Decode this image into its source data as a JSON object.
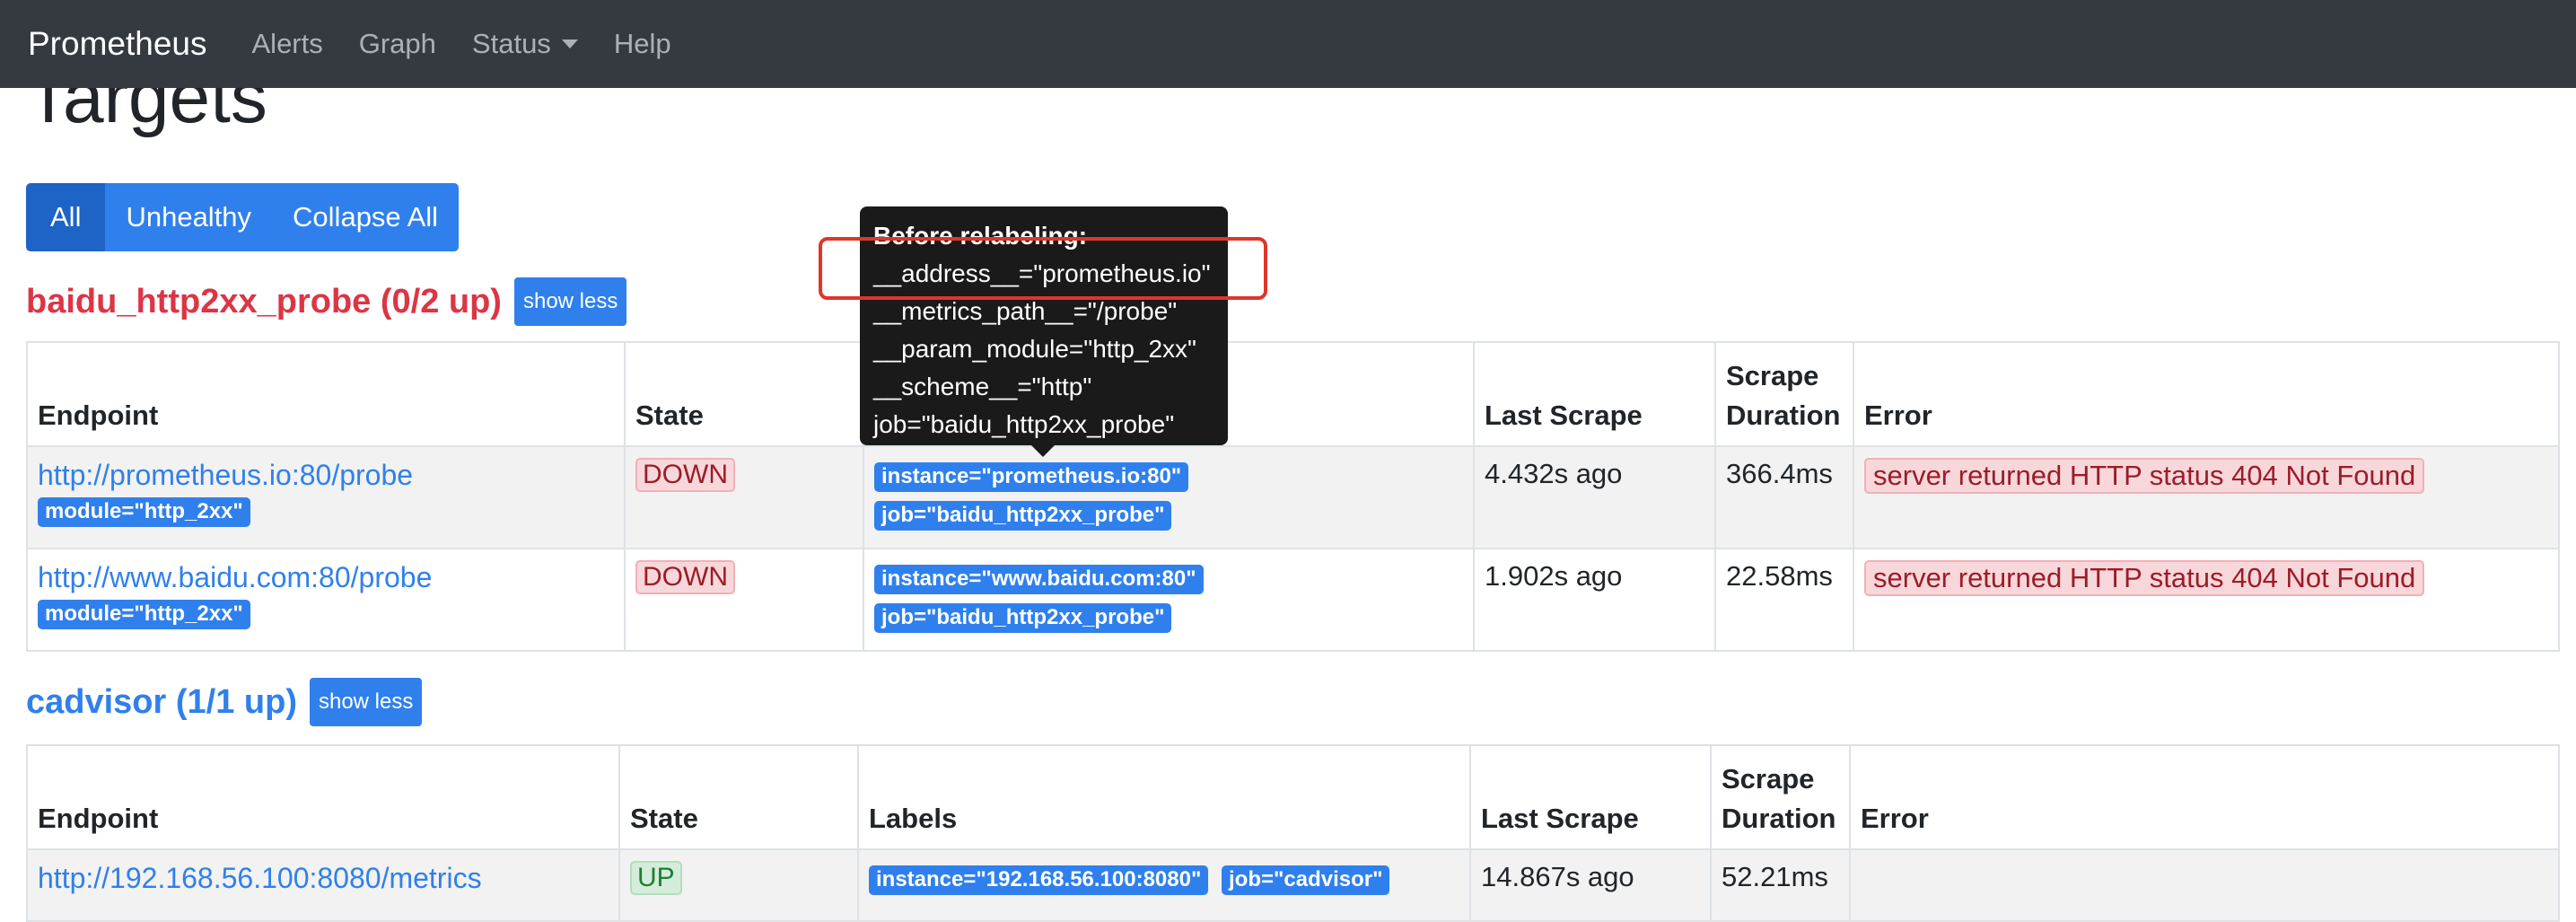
{
  "navbar": {
    "brand": "Prometheus",
    "items": [
      {
        "label": "Alerts"
      },
      {
        "label": "Graph"
      },
      {
        "label": "Status"
      },
      {
        "label": "Help"
      }
    ]
  },
  "page": {
    "title": "Targets"
  },
  "filter_buttons": {
    "all": "All",
    "unhealthy": "Unhealthy",
    "collapse": "Collapse All"
  },
  "table_headers": {
    "endpoint": "Endpoint",
    "state": "State",
    "labels": "Labels",
    "last_scrape": "Last Scrape",
    "scrape_duration_1": "Scrape",
    "scrape_duration_2": "Duration",
    "error": "Error"
  },
  "pools": [
    {
      "title": "baidu_http2xx_probe (0/2 up)",
      "toggle_label": "show less",
      "status_color": "#dc3545",
      "rows": [
        {
          "endpoint": "http://prometheus.io:80/probe",
          "endpoint_params": "module=\"http_2xx\"",
          "state": "DOWN",
          "labels": [
            "instance=\"prometheus.io:80\"",
            "job=\"baidu_http2xx_probe\""
          ],
          "last_scrape": "4.432s ago",
          "scrape_duration": "366.4ms",
          "error": "server returned HTTP status 404 Not Found"
        },
        {
          "endpoint": "http://www.baidu.com:80/probe",
          "endpoint_params": "module=\"http_2xx\"",
          "state": "DOWN",
          "labels": [
            "instance=\"www.baidu.com:80\"",
            "job=\"baidu_http2xx_probe\""
          ],
          "last_scrape": "1.902s ago",
          "scrape_duration": "22.58ms",
          "error": "server returned HTTP status 404 Not Found"
        }
      ]
    },
    {
      "title": "cadvisor (1/1 up)",
      "toggle_label": "show less",
      "status_color": "#2f80ed",
      "rows": [
        {
          "endpoint": "http://192.168.56.100:8080/metrics",
          "state": "UP",
          "labels": [
            "instance=\"192.168.56.100:8080\"",
            "job=\"cadvisor\""
          ],
          "last_scrape": "14.867s ago",
          "scrape_duration": "52.21ms",
          "error": ""
        }
      ]
    }
  ],
  "tooltip": {
    "heading": "Before relabeling:",
    "lines": [
      "__address__=\"prometheus.io\"",
      "__metrics_path__=\"/probe\"",
      "__param_module=\"http_2xx\"",
      "__scheme__=\"http\"",
      "job=\"baidu_http2xx_probe\""
    ]
  },
  "colors": {
    "navbar": "#343a40",
    "primary": "#2f80ed",
    "danger": "#dc3545",
    "annotation_box": "#e0352b"
  }
}
